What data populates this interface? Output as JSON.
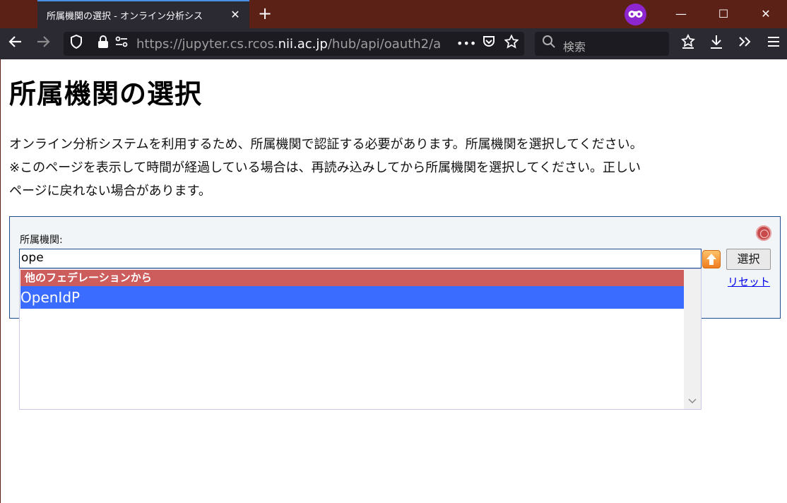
{
  "browser": {
    "tab_title": "所属機関の選択 - オンライン分析シス",
    "tab_close": "✕",
    "new_tab": "+",
    "url_prefix": "https://jupyter.cs.rcos.",
    "url_host": "nii.ac.jp",
    "url_suffix": "/hub/api/oauth2/a",
    "url_more": "•••",
    "search_placeholder": "検索",
    "window_minimize": "—",
    "window_maximize": "☐",
    "window_close": "✕"
  },
  "page": {
    "heading": "所属機関の選択",
    "description_line1": "オンライン分析システムを利用するため、所属機関で認証する必要があります。所属機関を選択してください。",
    "description_line2": "※このページを表示して時間が経過している場合は、再読み込みしてから所属機関を選択してください。正しい",
    "description_line3": "ページに戻れない場合があります。"
  },
  "wayf": {
    "label": "所属機関:",
    "input_value": "ope",
    "select_button": "選択",
    "reset_link": "リセット",
    "dropdown_group": "他のフェデレーションから",
    "dropdown_items": [
      "OpenIdP"
    ]
  },
  "colors": {
    "group_header": "#cd5c5c",
    "selected_item": "#3a6cff",
    "link": "#0000ee"
  }
}
